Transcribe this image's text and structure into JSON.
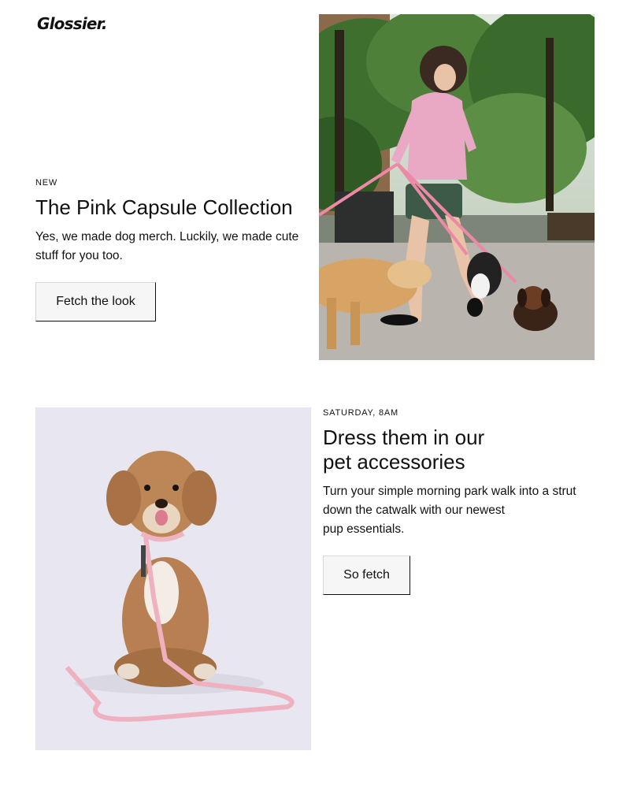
{
  "brand": {
    "logo_text": "Glossier."
  },
  "section_one": {
    "eyebrow": "NEW",
    "heading": "The Pink Capsule Collection",
    "body": "Yes, we made dog merch. Luckily, we made cute stuff for you too.",
    "cta_label": "Fetch the look",
    "image_icon": "woman-walking-dogs-photo"
  },
  "section_two": {
    "eyebrow": "SATURDAY, 8AM",
    "heading_line1": "Dress them in our",
    "heading_line2": "pet accessories",
    "body_line1": "Turn your simple morning park walk into a strut",
    "body_line2": "down the catwalk with our newest",
    "body_line3": "pup essentials.",
    "cta_label": "So fetch",
    "image_icon": "poodle-with-pink-leash-photo"
  },
  "colors": {
    "text": "#111111",
    "button_bg": "#f6f6f6",
    "accent_pink": "#e8a7b8",
    "background": "#ffffff"
  }
}
